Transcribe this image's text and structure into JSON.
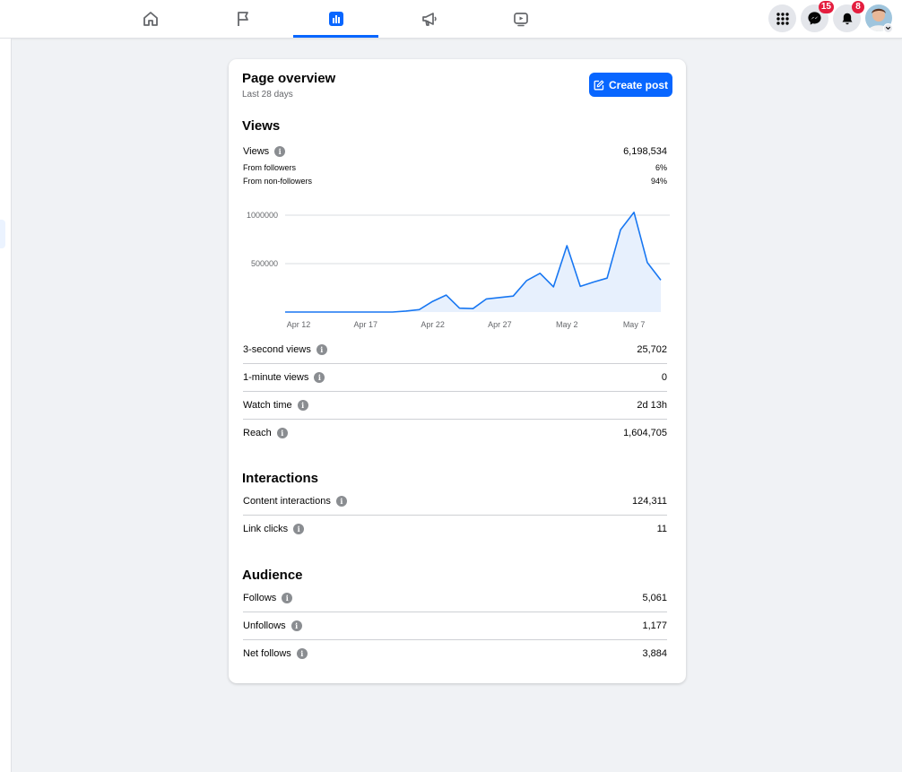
{
  "nav": {
    "tabs": [
      {
        "name": "home-icon",
        "active": false
      },
      {
        "name": "flag-icon",
        "active": false
      },
      {
        "name": "insights-icon",
        "active": true
      },
      {
        "name": "megaphone-icon",
        "active": false
      },
      {
        "name": "video-icon",
        "active": false
      }
    ],
    "accent_color": "#0866ff"
  },
  "header": {
    "messenger_badge": "15",
    "notifications_badge": "8",
    "badge_color": "#e41e3f"
  },
  "card": {
    "title": "Page overview",
    "subtitle": "Last 28 days",
    "create_post_label": "Create post"
  },
  "views_section": {
    "heading": "Views",
    "total": {
      "label": "Views",
      "value": "6,198,534"
    },
    "breakdown": [
      {
        "label": "From followers",
        "value": "6%"
      },
      {
        "label": "From non-followers",
        "value": "94%"
      }
    ],
    "metrics": [
      {
        "label": "3-second views",
        "value": "25,702"
      },
      {
        "label": "1-minute views",
        "value": "0"
      },
      {
        "label": "Watch time",
        "value": "2d 13h"
      },
      {
        "label": "Reach",
        "value": "1,604,705"
      }
    ]
  },
  "interactions_section": {
    "heading": "Interactions",
    "metrics": [
      {
        "label": "Content interactions",
        "value": "124,311"
      },
      {
        "label": "Link clicks",
        "value": "11"
      }
    ]
  },
  "audience_section": {
    "heading": "Audience",
    "metrics": [
      {
        "label": "Follows",
        "value": "5,061"
      },
      {
        "label": "Unfollows",
        "value": "1,177"
      },
      {
        "label": "Net follows",
        "value": "3,884"
      }
    ]
  },
  "chart_data": {
    "type": "area",
    "x_tick_labels": [
      "Apr 12",
      "Apr 17",
      "Apr 22",
      "Apr 27",
      "May 2",
      "May 7"
    ],
    "x_tick_indices": [
      1,
      6,
      11,
      16,
      21,
      26
    ],
    "y_tick_labels": [
      "1000000",
      "500000"
    ],
    "y_ticks": [
      1000000,
      500000
    ],
    "ylim": [
      0,
      1000000
    ],
    "grid": true,
    "line_color": "#1877f2",
    "fill_color": "#e7f0fd",
    "series": [
      {
        "values": [
          0,
          0,
          0,
          0,
          0,
          0,
          0,
          0,
          0,
          10000,
          25000,
          110000,
          175000,
          40000,
          35000,
          135000,
          150000,
          165000,
          325000,
          400000,
          260000,
          685000,
          265000,
          310000,
          350000,
          850000,
          1030000,
          510000,
          330000
        ]
      }
    ]
  }
}
